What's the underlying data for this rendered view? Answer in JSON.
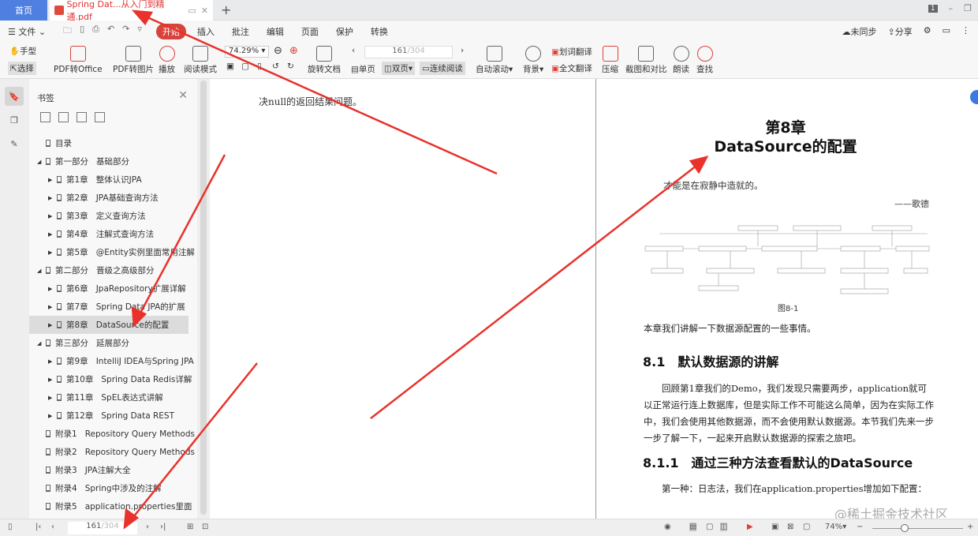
{
  "tabs": {
    "home": "首页",
    "document": "Spring Dat...从入门到精通.pdf",
    "window_badge": "1"
  },
  "menu": {
    "file": "文件",
    "items": [
      "开始",
      "插入",
      "批注",
      "编辑",
      "页面",
      "保护",
      "转换"
    ],
    "sync": "未同步",
    "share": "分享"
  },
  "toolbar": {
    "hand": "手型",
    "select": "选择",
    "pdf_to_office": "PDF转Office",
    "pdf_to_image": "PDF转图片",
    "play": "播放",
    "read_mode": "阅读模式",
    "zoom": "74.29%",
    "rotate": "旋转文档",
    "page_current": "161",
    "page_total": "/304",
    "single": "单页",
    "double": "双页",
    "continuous": "连续阅读",
    "auto_scroll": "自动滚动",
    "background": "背景",
    "word_translate": "划词翻译",
    "full_translate": "全文翻译",
    "compress": "压缩",
    "screenshot": "截图和对比",
    "read_aloud": "朗读",
    "find": "查找"
  },
  "bookmarks": {
    "title": "书签",
    "items": [
      {
        "level": 0,
        "expand": "",
        "num": "目录",
        "label": ""
      },
      {
        "level": 0,
        "expand": "open",
        "num": "第一部分",
        "label": "基础部分"
      },
      {
        "level": 1,
        "expand": "closed",
        "num": "第1章",
        "label": "整体认识JPA"
      },
      {
        "level": 1,
        "expand": "closed",
        "num": "第2章",
        "label": "JPA基础查询方法"
      },
      {
        "level": 1,
        "expand": "closed",
        "num": "第3章",
        "label": "定义查询方法"
      },
      {
        "level": 1,
        "expand": "closed",
        "num": "第4章",
        "label": "注解式查询方法"
      },
      {
        "level": 1,
        "expand": "closed",
        "num": "第5章",
        "label": "@Entity实例里面常用注解"
      },
      {
        "level": 0,
        "expand": "open",
        "num": "第二部分",
        "label": "晋级之高级部分"
      },
      {
        "level": 1,
        "expand": "closed",
        "num": "第6章",
        "label": "JpaRepository扩展详解"
      },
      {
        "level": 1,
        "expand": "closed",
        "num": "第7章",
        "label": "Spring Data JPA的扩展"
      },
      {
        "level": 1,
        "expand": "closed",
        "num": "第8章",
        "label": "DataSource的配置",
        "selected": true
      },
      {
        "level": 0,
        "expand": "open",
        "num": "第三部分",
        "label": "延展部分"
      },
      {
        "level": 1,
        "expand": "closed",
        "num": "第9章",
        "label": "IntelliJ IDEA与Spring JPA"
      },
      {
        "level": 1,
        "expand": "closed",
        "num": "第10章",
        "label": "Spring Data Redis详解"
      },
      {
        "level": 1,
        "expand": "closed",
        "num": "第11章",
        "label": "SpEL表达式讲解"
      },
      {
        "level": 1,
        "expand": "closed",
        "num": "第12章",
        "label": "Spring Data REST"
      },
      {
        "level": 0,
        "expand": "",
        "num": "附录1",
        "label": "Repository Query Methods"
      },
      {
        "level": 0,
        "expand": "",
        "num": "附录2",
        "label": "Repository Query Methods"
      },
      {
        "level": 0,
        "expand": "",
        "num": "附录3",
        "label": "JPA注解大全"
      },
      {
        "level": 0,
        "expand": "",
        "num": "附录4",
        "label": "Spring中涉及的注解"
      },
      {
        "level": 0,
        "expand": "",
        "num": "附录5",
        "label": "application.properties里面"
      }
    ]
  },
  "page": {
    "left_text": "决null的返回结果问题。",
    "chapter_num": "第8章",
    "chapter_title": "DataSource的配置",
    "epigraph": "才能是在寂静中造就的。",
    "epigraph_author": "——歌德",
    "figure_caption": "图8-1",
    "intro": "本章我们讲解一下数据源配置的一些事情。",
    "h_8_1": "8.1　默认数据源的讲解",
    "p1": "　　回顾第1章我们的Demo，我们发现只需要两步，application就可以正常运行连上数据库，但是实际工作不可能这么简单，因为在实际工作中，我们会使用其他数据源，而不会使用默认数据源。本节我们先来一步一步了解一下，一起来开启默认数据源的探索之旅吧。",
    "h_8_1_1": "8.1.1　通过三种方法查看默认的DataSource",
    "p2": "　　第一种：日志法，我们在application.properties增加如下配置：",
    "watermark": "@稀土掘金技术社区"
  },
  "status": {
    "page_current": "161",
    "page_total": "/304",
    "zoom": "74%"
  },
  "colors": {
    "accent": "#d9423a",
    "home_tab": "#4f7fe0",
    "annotation": "#e8322b"
  }
}
